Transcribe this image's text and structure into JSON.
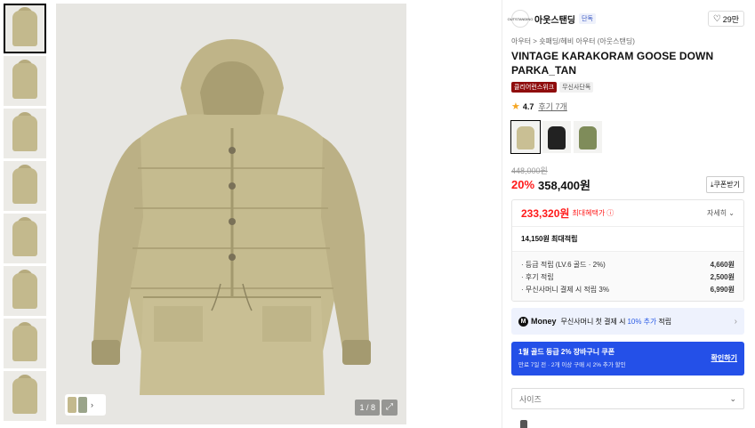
{
  "gallery": {
    "thumbnail_count": 8,
    "active_index": 0,
    "counter": "1 / 8",
    "expand_icon": "expand-icon"
  },
  "brand": {
    "logo_text": "OUTSTANDING",
    "name": "아웃스탠딩",
    "tag": "단독",
    "like_count": "29만"
  },
  "breadcrumb": "아우터 > 숏패딩/헤비 아우터 (아웃스탠딩)",
  "product": {
    "title": "VINTAGE KARAKORAM GOOSE DOWN PARKA_TAN",
    "badge_red": "클리어런스위크",
    "badge_gray": "무신사단독",
    "rating": "4.7",
    "reviews": "후기 7개",
    "swatch_colors": [
      "#c9bf94",
      "#222222",
      "#7f8c5a"
    ]
  },
  "price": {
    "original": "448,000원",
    "discount": "20%",
    "current": "358,400원",
    "coupon_button": "쿠폰받기"
  },
  "benefit": {
    "max_price": "233,320원",
    "max_label": "최대혜택가",
    "detail": "자세히",
    "points_total": "14,150원 최대적립",
    "rows": [
      {
        "label": "· 등급 적립 (LV.6 골드 · 2%)",
        "value": "4,660원"
      },
      {
        "label": "· 후기 적립",
        "value": "2,500원"
      },
      {
        "label": "· 무신사머니 결제 시 적립 3%",
        "value": "6,990원"
      }
    ]
  },
  "money": {
    "brand": "Money",
    "text_pre": "무신사머니 첫 결제 시",
    "text_hi": "10% 추가",
    "text_post": "적립"
  },
  "coupon": {
    "title": "1월 골드 등급 2% 장바구니 쿠폰",
    "sub": "만료 7일 전 · 2개 이상 구매 시 2% 추가 할인",
    "link": "확인하기"
  },
  "size": {
    "placeholder": "사이즈"
  }
}
